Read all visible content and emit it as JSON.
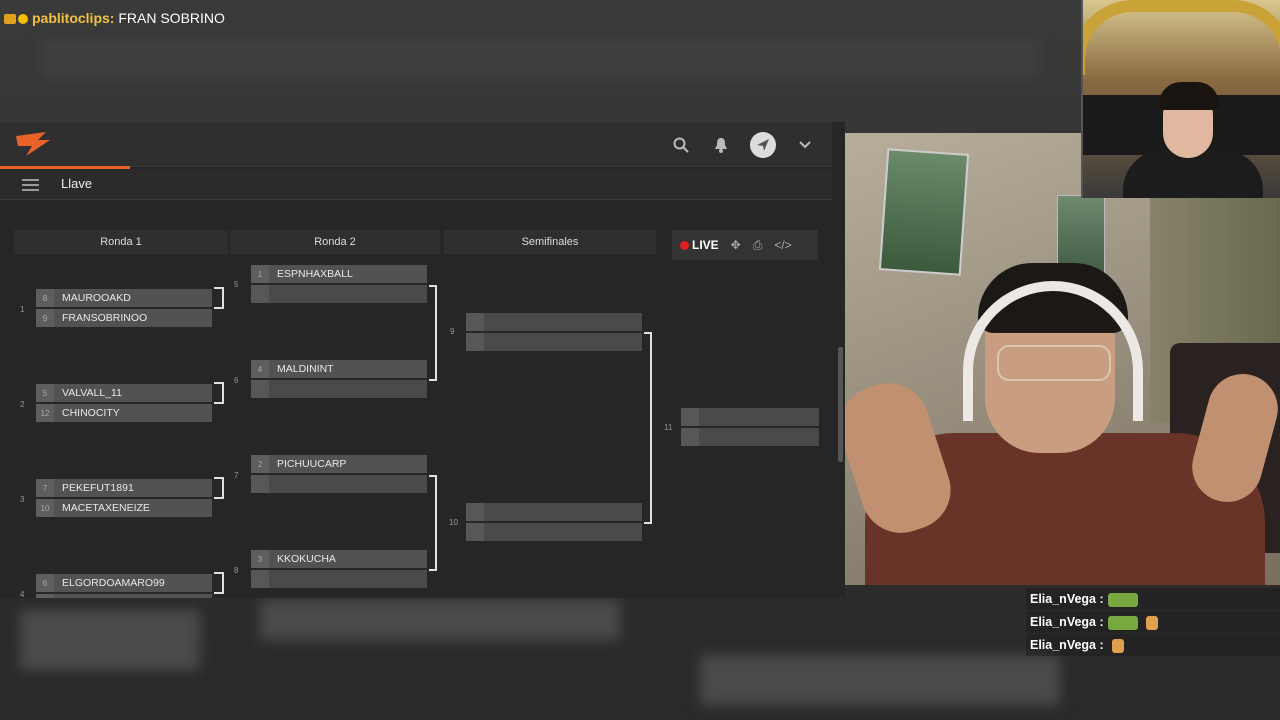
{
  "chat_overlay": {
    "partial_line": "pablitoclips: FRAN SOBRINO",
    "username": "pablitoclips:",
    "message": "FRAN SOBRINO"
  },
  "app": {
    "page_title": "Llave",
    "accent_color": "#e8622a",
    "rounds": [
      "Ronda 1",
      "Ronda 2",
      "Semifinales"
    ],
    "live_label": "LIVE",
    "round1": [
      {
        "match": "1",
        "next": "5",
        "p1": {
          "seed": "8",
          "name": "MAUROOAKD"
        },
        "p2": {
          "seed": "9",
          "name": "FRANSOBRINOO"
        }
      },
      {
        "match": "2",
        "next": "6",
        "p1": {
          "seed": "5",
          "name": "VALVALL_11"
        },
        "p2": {
          "seed": "12",
          "name": "CHINOCITY"
        }
      },
      {
        "match": "3",
        "next": "7",
        "p1": {
          "seed": "7",
          "name": "PEKEFUT1891"
        },
        "p2": {
          "seed": "10",
          "name": "MACETAXENEIZE"
        }
      },
      {
        "match": "4",
        "next": "8",
        "p1": {
          "seed": "6",
          "name": "ELGORDOAMARO99"
        },
        "p2": {
          "seed": "",
          "name": ""
        }
      }
    ],
    "round2": [
      {
        "seed": "1",
        "name": "ESPNHAXBALL"
      },
      {
        "seed": "4",
        "name": "MALDININT"
      },
      {
        "seed": "2",
        "name": "PICHUUCARP"
      },
      {
        "seed": "3",
        "name": "KKOKUCHA"
      }
    ],
    "semis": [
      "9",
      "10"
    ],
    "final": "11"
  },
  "side_chat": [
    {
      "user": "Elia_nVega :"
    },
    {
      "user": "Elia_nVega :"
    },
    {
      "user": "Elia_nVega :"
    }
  ]
}
